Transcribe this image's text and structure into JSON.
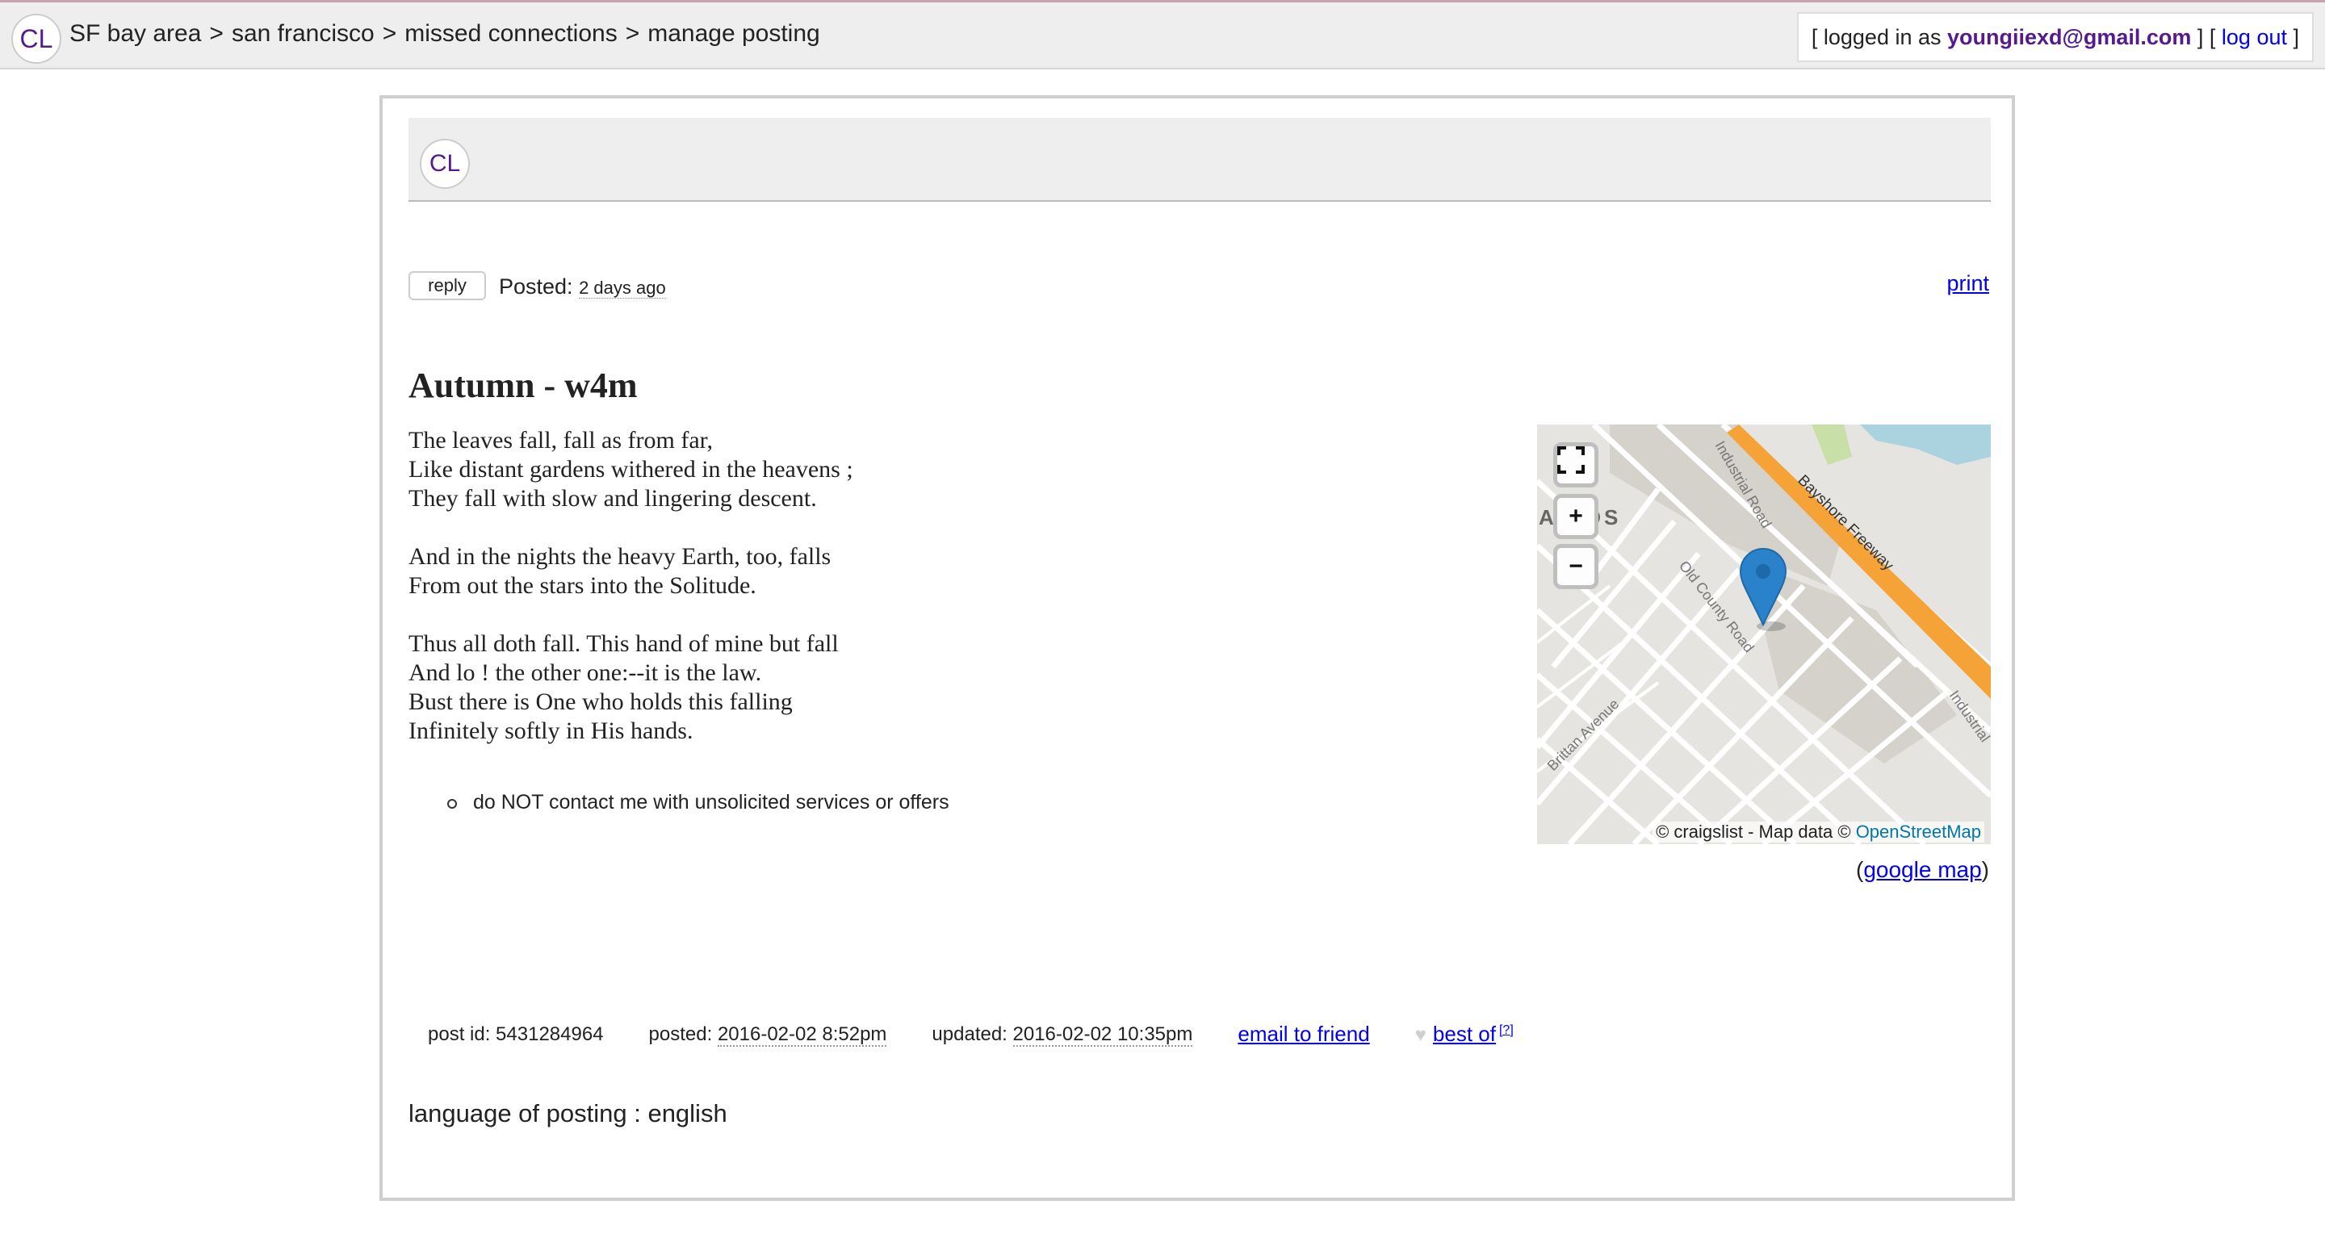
{
  "topbar": {
    "logo": "CL",
    "breadcrumb": [
      "SF bay area",
      "san francisco",
      "missed connections",
      "manage posting"
    ],
    "separator": ">",
    "user": {
      "prefix": "[ logged in as ",
      "email": "youngiiexd@gmail.com",
      "middle": " ] [ ",
      "logout": "log out",
      "suffix": " ]"
    }
  },
  "inner_header": {
    "logo": "CL"
  },
  "post_actions": {
    "reply_label": "reply",
    "posted_label": "Posted:",
    "posted_ago": "2 days ago",
    "print_label": "print"
  },
  "post": {
    "title": "Autumn - w4m",
    "stanzas": [
      [
        "The leaves fall, fall as from far,",
        "Like distant gardens withered in the heavens ;",
        "They fall with slow and lingering descent."
      ],
      [
        "And in the nights the heavy Earth, too, falls",
        "From out the stars into the Solitude."
      ],
      [
        "Thus all doth fall. This hand of mine but fall",
        "And lo ! the other one:--it is the law.",
        "Bust there is One who holds this falling",
        "Infinitely softly in His hands."
      ]
    ],
    "notice": "do NOT contact me with unsolicited services or offers"
  },
  "map": {
    "controls": {
      "fullscreen_icon": "fullscreen-icon",
      "zoom_in": "+",
      "zoom_out": "−"
    },
    "overlay_text": "AR OS",
    "street_labels": [
      "Industrial Road",
      "Bayshore Freeway",
      "Old County Road",
      "Brittan Avenue",
      "Industrial"
    ],
    "attribution_prefix": "© craigslist - Map data © ",
    "attribution_link": "OpenStreetMap",
    "google_open": "(",
    "google_link": "google map",
    "google_close": ")",
    "colors": {
      "freeway": "#f5a236",
      "water": "#aad3df",
      "park": "#c8dfa8",
      "marker": "#2a82cb"
    }
  },
  "footer": {
    "post_id_label": "post id: 5431284964",
    "posted_label": "posted: ",
    "posted_value": "2016-02-02 8:52pm",
    "updated_label": "updated: ",
    "updated_value": "2016-02-02 10:35pm",
    "email_friend": "email to friend",
    "best_of": "best of",
    "best_of_help": "[?]",
    "language": "language of posting : english"
  }
}
